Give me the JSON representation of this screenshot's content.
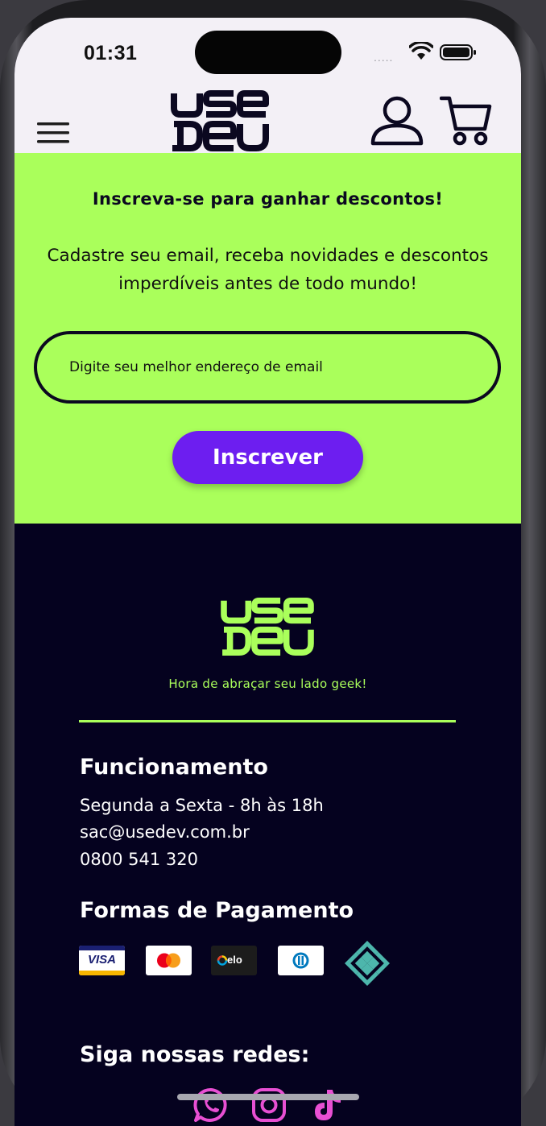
{
  "status_bar": {
    "time": "01:31",
    "signal": "....."
  },
  "header": {
    "logo_line1": "USE",
    "logo_line2": "DEV",
    "icons": [
      "menu-icon",
      "user-icon",
      "cart-icon"
    ],
    "logo_color": "#0b0820"
  },
  "newsletter": {
    "title": "Inscreva-se para ganhar descontos!",
    "description": "Cadastre seu email, receba novidades e descontos imperdíveis antes de todo mundo!",
    "email_placeholder": "Digite seu melhor endereço de email",
    "button_label": "Inscrever",
    "background": "#aaff5b",
    "button_color": "#6d1ef0"
  },
  "footer": {
    "logo_line1": "USE",
    "logo_line2": "DEV",
    "slogan": "Hora de abraçar seu lado geek!",
    "hours_title": "Funcionamento",
    "hours": "Segunda a Sexta - 8h às 18h",
    "email": "sac@usedev.com.br",
    "phone": "0800 541 320",
    "payment_title": "Formas de Pagamento",
    "payment_methods": [
      "VISA",
      "mastercard",
      "elo",
      "diners-club",
      "pix"
    ],
    "visa_label": "VISA",
    "elo_label": "elo",
    "social_title": "Siga nossas redes:",
    "social_networks": [
      "whatsapp-icon",
      "instagram-icon",
      "tiktok-icon"
    ],
    "background": "#05021f",
    "accent": "#aaff5b",
    "social_color": "#e84fd3"
  }
}
